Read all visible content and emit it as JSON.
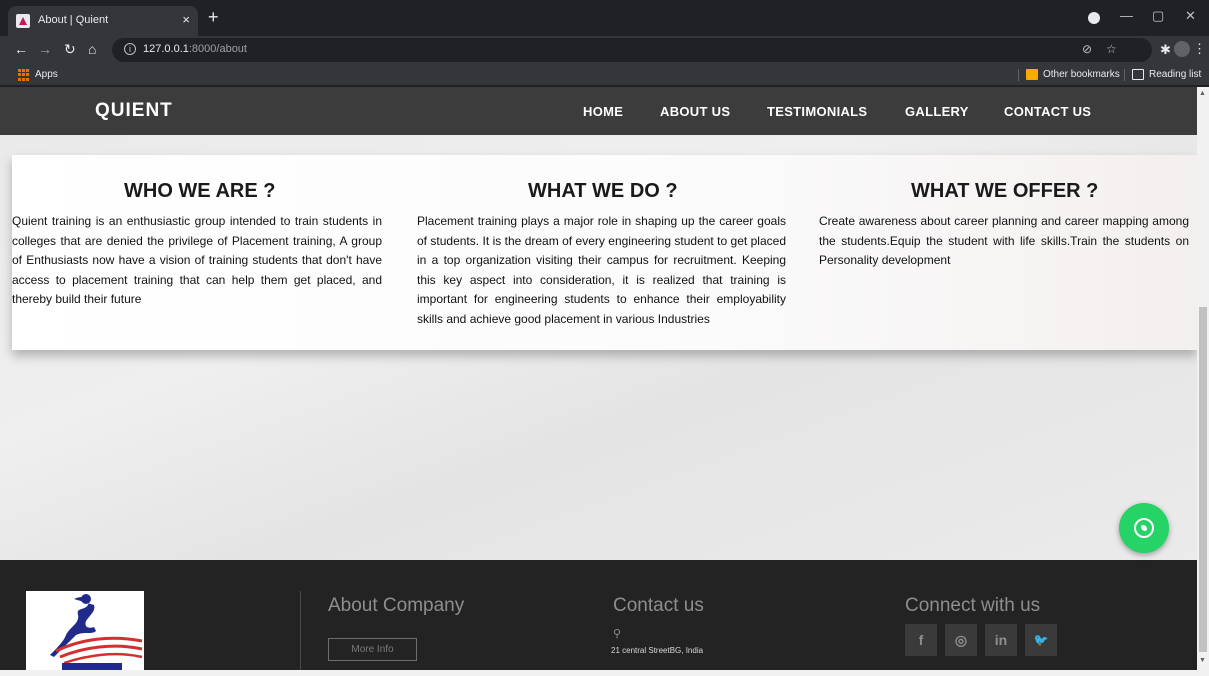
{
  "browser": {
    "tab_title": "About | Quient",
    "tab_close": "×",
    "new_tab": "+",
    "url_host": "127.0.0.1",
    "url_path": ":8000/about",
    "bookmarks": {
      "apps": "Apps",
      "other": "Other bookmarks",
      "reading": "Reading list"
    }
  },
  "site": {
    "brand": "QUIENT",
    "nav": [
      "HOME",
      "ABOUT US",
      "TESTIMONIALS",
      "GALLERY",
      "CONTACT US"
    ]
  },
  "sections": [
    {
      "title": "WHO WE ARE ?",
      "body": "Quient training is an enthusiastic group intended to train students in colleges that are denied the privilege of Placement training, A group of Enthusiasts now have a vision of training students that don't have access to placement training that can help them get placed, and thereby build their future"
    },
    {
      "title": "WHAT WE DO ?",
      "body": "Placement training plays a major role in shaping up the career goals of students. It is the dream of every engineering student to get placed in a top organization visiting their campus for recruitment. Keeping this key aspect into consideration, it is realized that training is important for engineering students to enhance their employability skills and achieve good placement in various Industries"
    },
    {
      "title": "WHAT WE OFFER ?",
      "body": "Create awareness about career planning and career mapping among the students.Equip the student with life skills.Train the students on Personality development"
    }
  ],
  "footer": {
    "about_title": "About Company",
    "more_info": "More Info",
    "contact_title": "Contact us",
    "address": "21 central StreetBG, India",
    "connect_title": "Connect with us",
    "social": [
      {
        "icon": "facebook-icon",
        "glyph": "f"
      },
      {
        "icon": "instagram-icon",
        "glyph": "◎"
      },
      {
        "icon": "linkedin-icon",
        "glyph": "in"
      },
      {
        "icon": "twitter-icon",
        "glyph": "🐦"
      }
    ]
  },
  "colors": {
    "header_bg": "#3c3c3c",
    "footer_bg": "#232323",
    "whatsapp": "#25d366"
  }
}
